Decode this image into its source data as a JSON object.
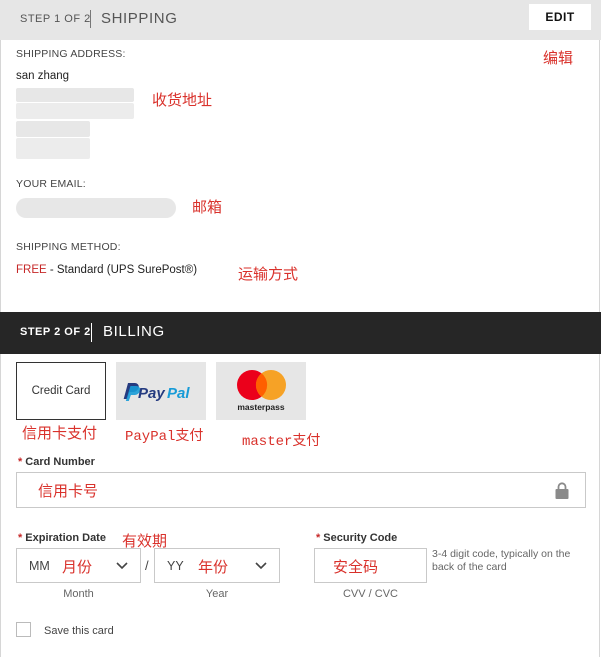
{
  "shipping": {
    "step_label": "STEP 1 OF 2",
    "title": "SHIPPING",
    "edit_label": "EDIT",
    "address_label": "SHIPPING ADDRESS:",
    "name": "san zhang",
    "email_label": "YOUR EMAIL:",
    "method_label": "SHIPPING METHOD:",
    "method_free": "FREE",
    "method_rest": " - Standard (UPS SurePost®)"
  },
  "billing": {
    "step_label": "STEP 2 OF 2",
    "title": "BILLING",
    "tabs": {
      "credit_card": "Credit Card",
      "paypal_pay": "Pay",
      "paypal_pal": "Pal",
      "masterpass": "masterpass"
    },
    "card_number_label": "Card Number",
    "expiration_label": "Expiration Date",
    "month_placeholder": "MM",
    "year_placeholder": "YY",
    "slash": "/",
    "month_caption": "Month",
    "year_caption": "Year",
    "security_label": "Security Code",
    "security_hint": "3-4 digit code, typically on the back of the card",
    "cvv_caption": "CVV / CVC",
    "save_label": "Save this card",
    "required_mark": "*"
  },
  "annotations": {
    "edit": "编辑",
    "address": "收货地址",
    "email": "邮箱",
    "method": "运输方式",
    "credit_card": "信用卡支付",
    "paypal": "PayPal支付",
    "master": "master支付",
    "card_number": "信用卡号",
    "expiration": "有效期",
    "month": "月份",
    "year": "年份",
    "security": "安全码"
  },
  "colors": {
    "annotation_red": "#d9312b",
    "paypal_dark": "#253b80",
    "paypal_light": "#179bd7",
    "mastercard_red": "#eb001b",
    "mastercard_orange": "#f79e1b"
  }
}
